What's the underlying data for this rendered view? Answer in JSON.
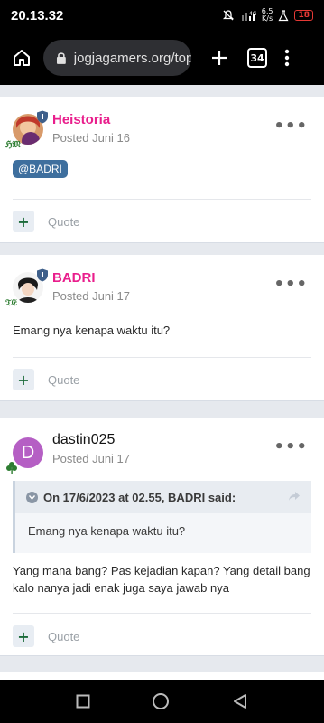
{
  "status": {
    "time": "20.13.32",
    "network": "4G",
    "speed": "6,5",
    "speed_unit": "K/s",
    "battery": "18"
  },
  "browser": {
    "url": "jogjagamers.org/top",
    "tab_count": "34"
  },
  "posts": [
    {
      "author": "Heistoria",
      "date": "Posted Juni 16",
      "mention": "@BADRI",
      "flair": "ℌ𝔐",
      "quote_label": "Quote"
    },
    {
      "author": "BADRI",
      "date": "Posted Juni 17",
      "text": "Emang nya kenapa waktu itu?",
      "flair": "𝔗𝔈",
      "quote_label": "Quote"
    },
    {
      "author": "dastin025",
      "date": "Posted Juni 17",
      "avatar_letter": "D",
      "blockquote": {
        "title": "On 17/6/2023 at 02.55, BADRI said:",
        "text": "Emang nya kenapa waktu itu?"
      },
      "text": "Yang mana bang? Pas kejadian kapan? Yang detail bang kalo nanya jadi enak juga saya jawab nya",
      "quote_label": "Quote"
    }
  ],
  "colors": {
    "mod_name": "#e91e8c",
    "mention_bg": "#3e6f9e",
    "react_green": "#1b6b3a"
  }
}
